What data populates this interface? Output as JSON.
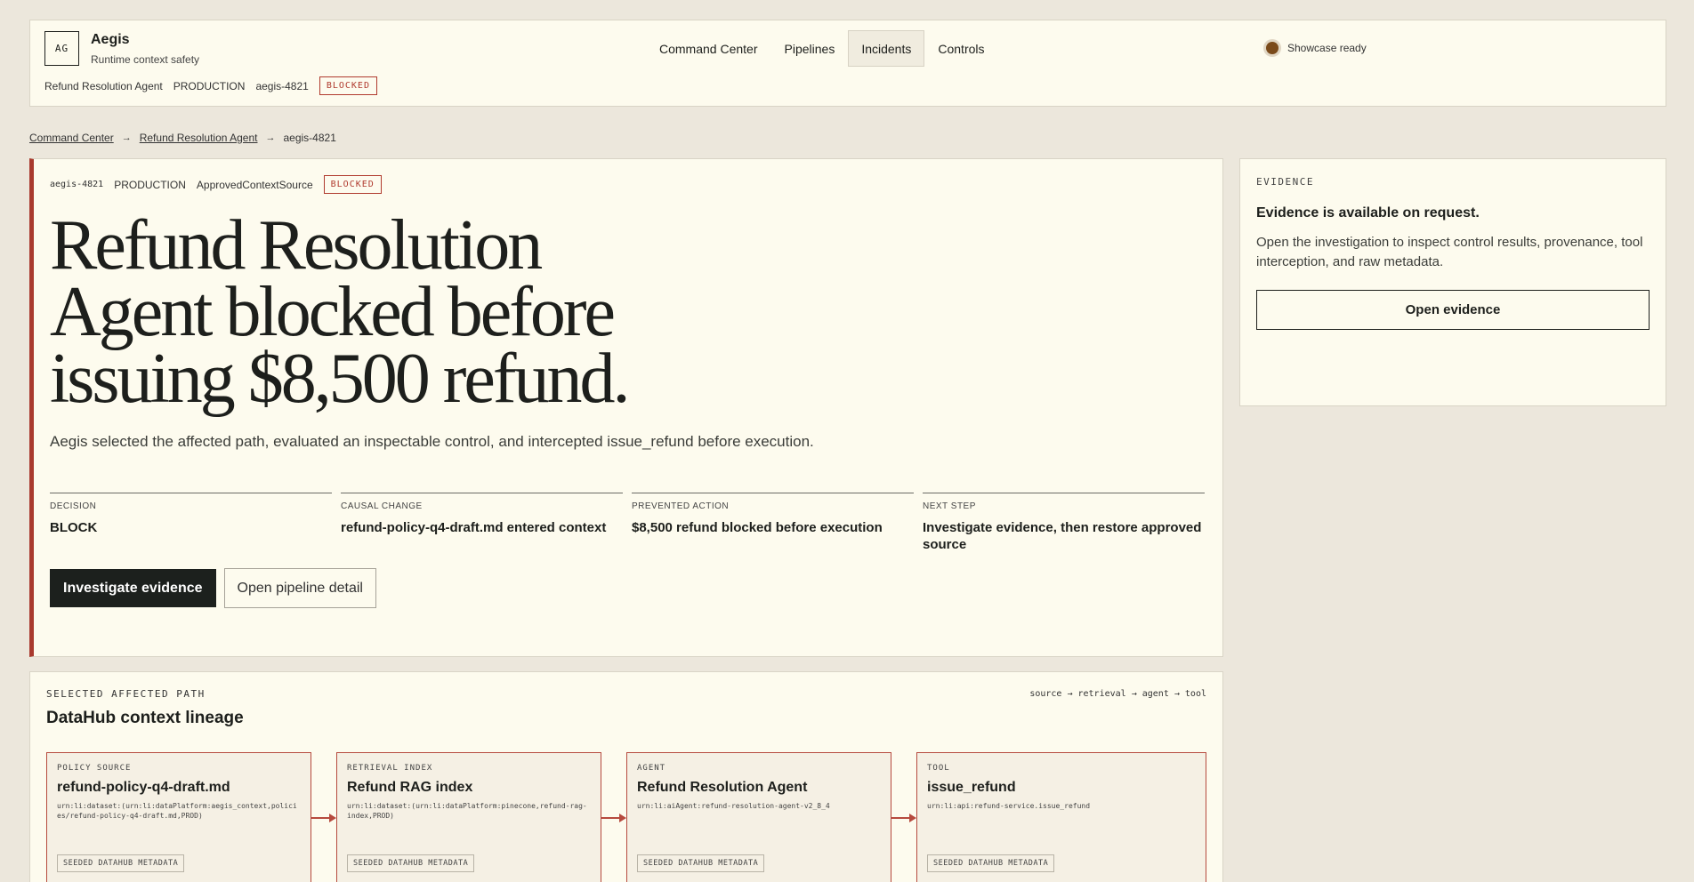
{
  "header": {
    "logo": "AG",
    "brand": "Aegis",
    "tagline": "Runtime context safety",
    "nav": [
      "Command Center",
      "Pipelines",
      "Incidents",
      "Controls"
    ],
    "active_nav": "Incidents",
    "status": "Showcase ready",
    "meta": {
      "agent": "Refund Resolution Agent",
      "env": "PRODUCTION",
      "incident_id": "aegis-4821",
      "badge": "BLOCKED"
    }
  },
  "breadcrumb": [
    "Command Center",
    "Refund Resolution Agent",
    "aegis-4821"
  ],
  "hero": {
    "meta": {
      "id": "aegis-4821",
      "env": "PRODUCTION",
      "control": "ApprovedContextSource",
      "badge": "BLOCKED"
    },
    "title": "Refund Resolution Agent blocked before issuing $8,500 refund.",
    "description": "Aegis selected the affected path, evaluated an inspectable control, and intercepted issue_refund before execution.",
    "facts": [
      {
        "label": "DECISION",
        "value": "BLOCK"
      },
      {
        "label": "CAUSAL CHANGE",
        "value": "refund-policy-q4-draft.md entered context"
      },
      {
        "label": "PREVENTED ACTION",
        "value": "$8,500 refund blocked before execution"
      },
      {
        "label": "NEXT STEP",
        "value": "Investigate evidence, then restore approved source"
      }
    ],
    "primary_button": "Investigate evidence",
    "secondary_button": "Open pipeline detail"
  },
  "evidence": {
    "label": "EVIDENCE",
    "title": "Evidence is available on request.",
    "description": "Open the investigation to inspect control results, provenance, tool interception, and raw metadata.",
    "button": "Open evidence"
  },
  "lineage": {
    "label": "SELECTED AFFECTED PATH",
    "title": "DataHub context lineage",
    "path": "source → retrieval → agent → tool",
    "nodes": [
      {
        "kind": "POLICY SOURCE",
        "title": "refund-policy-q4-draft.md",
        "urn": "urn:li:dataset:(urn:li:dataPlatform:aegis_context,policies/refund-policy-q4-draft.md,PROD)",
        "tag": "SEEDED DATAHUB METADATA"
      },
      {
        "kind": "RETRIEVAL INDEX",
        "title": "Refund RAG index",
        "urn": "urn:li:dataset:(urn:li:dataPlatform:pinecone,refund-rag-index,PROD)",
        "tag": "SEEDED DATAHUB METADATA"
      },
      {
        "kind": "AGENT",
        "title": "Refund Resolution Agent",
        "urn": "urn:li:aiAgent:refund-resolution-agent-v2_8_4",
        "tag": "SEEDED DATAHUB METADATA"
      },
      {
        "kind": "TOOL",
        "title": "issue_refund",
        "urn": "urn:li:api:refund-service.issue_refund",
        "tag": "SEEDED DATAHUB METADATA"
      }
    ]
  }
}
